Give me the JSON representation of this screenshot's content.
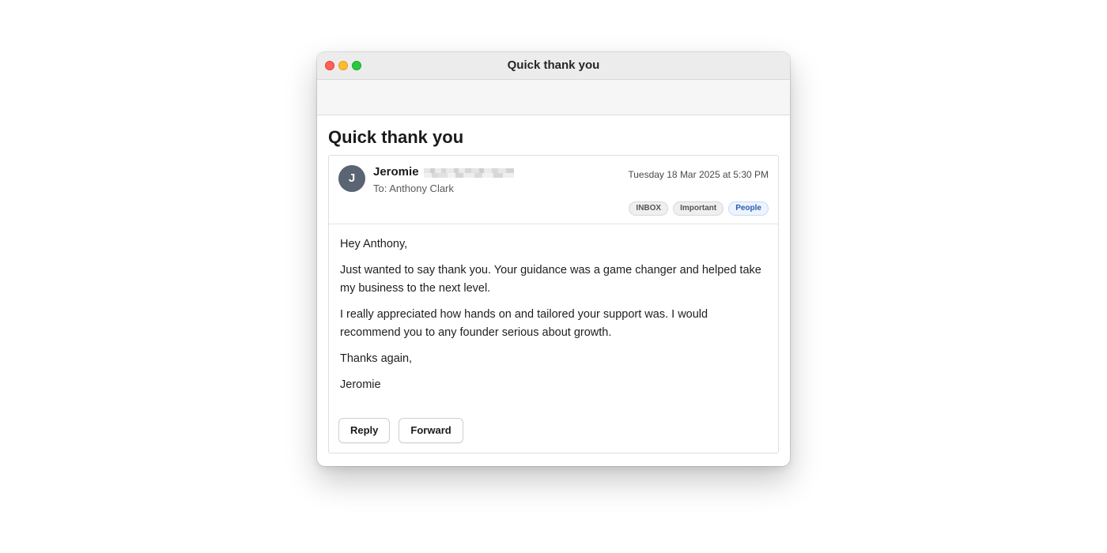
{
  "window": {
    "title": "Quick thank you"
  },
  "email": {
    "subject": "Quick thank you",
    "sender": {
      "initial": "J",
      "name": "Jeromie"
    },
    "to_line": "To: Anthony Clark",
    "date": "Tuesday 18 Mar 2025 at 5:30 PM",
    "labels": [
      "INBOX",
      "Important",
      "People"
    ],
    "body": [
      "Hey Anthony,",
      "Just wanted to say thank you. Your guidance was a game changer and helped take my business to the next level.",
      "I really appreciated how hands on and tailored your support was. I would recommend you to any founder serious about growth.",
      "Thanks again,",
      "Jeromie"
    ]
  },
  "actions": {
    "reply_label": "Reply",
    "forward_label": "Forward"
  },
  "colors": {
    "avatar": "#5a6472",
    "people_label": "#2a5db0",
    "close": "#ff5f57",
    "minimize": "#febc2e",
    "zoom": "#28c840"
  }
}
